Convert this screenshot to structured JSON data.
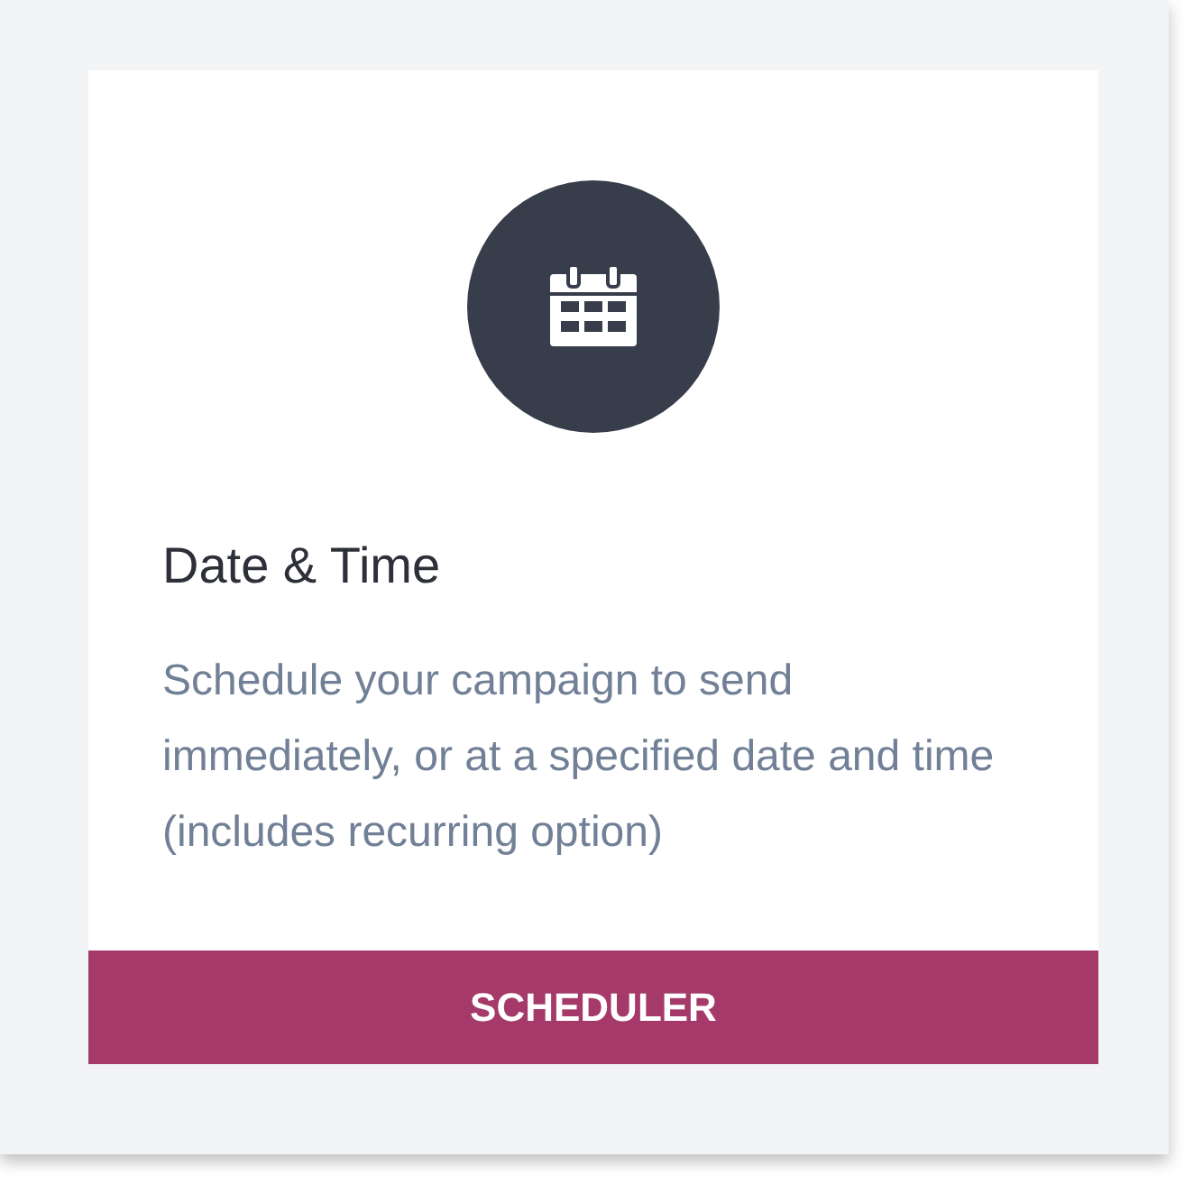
{
  "card": {
    "title": "Date & Time",
    "description": "Schedule your campaign to send immediately, or at a specified date and time (includes recurring option)",
    "button": "SCHEDULER"
  }
}
